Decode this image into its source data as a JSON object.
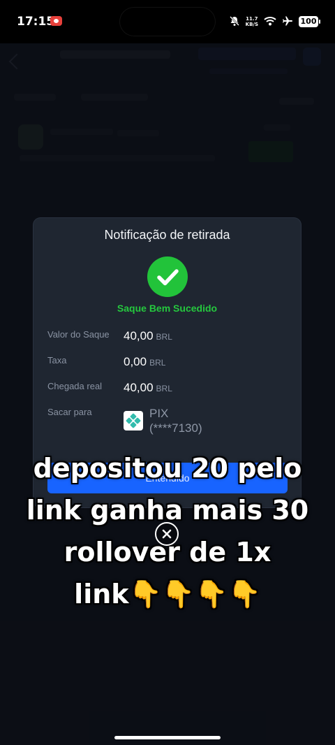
{
  "status_bar": {
    "time": "17:15",
    "net_speed_value": "11.7",
    "net_speed_unit": "KB/S",
    "battery": "100",
    "icons": [
      "screen-record-icon",
      "mute-bell-icon",
      "wifi-icon",
      "airplane-icon",
      "battery-icon"
    ]
  },
  "modal": {
    "title": "Notificação de retirada",
    "status": "Saque Bem Sucedido",
    "rows": [
      {
        "label": "Valor do Saque",
        "value": "40,00",
        "unit": "BRL"
      },
      {
        "label": "Taxa",
        "value": "0,00",
        "unit": "BRL"
      },
      {
        "label": "Chegada real",
        "value": "40,00",
        "unit": "BRL"
      }
    ],
    "destination": {
      "label": "Sacar para",
      "method": "PIX",
      "account": "(****7130)"
    },
    "button_label": "Entendido"
  },
  "caption": {
    "lines": [
      "depositou 20 pelo",
      "link ganha mais 30",
      "rollover de 1x",
      "link👇👇👇👇"
    ]
  },
  "colors": {
    "success": "#25c83e",
    "primary_button": "#1864ff",
    "modal_bg": "#1f2631"
  }
}
